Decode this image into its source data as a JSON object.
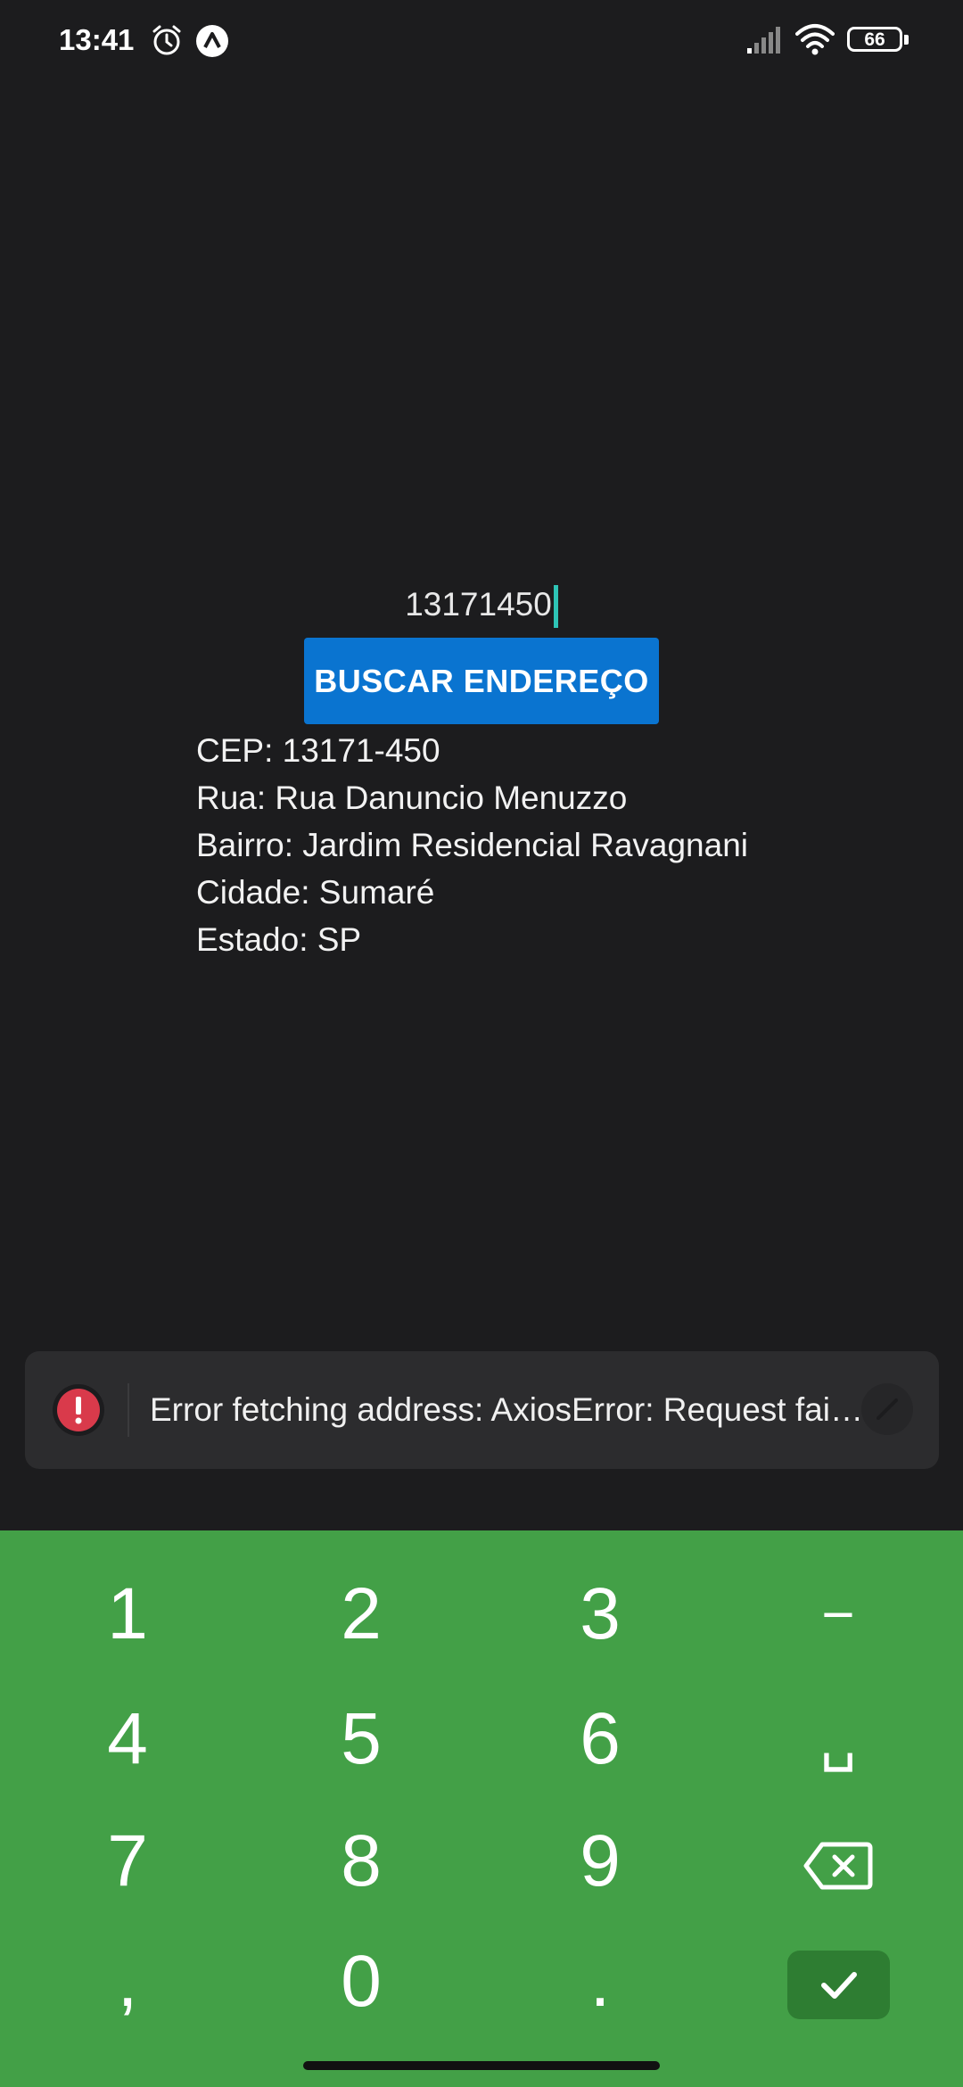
{
  "status_bar": {
    "time": "13:41",
    "battery": "66",
    "icons": [
      "alarm-icon",
      "app-a-icon",
      "signal-icon",
      "wifi-icon",
      "battery-icon"
    ]
  },
  "form": {
    "cep_value": "13171450",
    "search_button_label": "BUSCAR ENDEREÇO"
  },
  "result": {
    "cep": "CEP: 13171-450",
    "rua": "Rua: Rua Danuncio Menuzzo",
    "bairro": "Bairro: Jardim Residencial Ravagnani",
    "cidade": "Cidade: Sumaré",
    "estado": "Estado: SP"
  },
  "toast": {
    "message": "Error fetching address: AxiosError: Request failed",
    "icon": "error-icon",
    "error_color": "#d93a4b"
  },
  "keyboard": {
    "background": "#43a047",
    "keys": [
      "1",
      "2",
      "3",
      "−",
      "4",
      "5",
      "6",
      "␣",
      "7",
      "8",
      "9",
      ",",
      "0",
      "."
    ],
    "enter_icon": "check-icon",
    "backspace_icon": "backspace-icon"
  }
}
